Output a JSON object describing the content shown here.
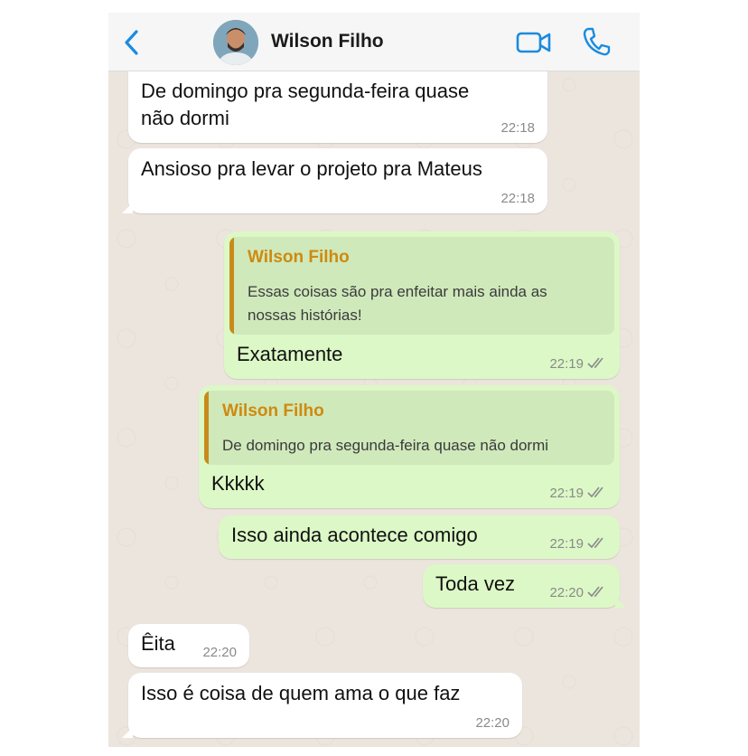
{
  "header": {
    "contact_name": "Wilson Filho",
    "icons": [
      "back-chevron-icon",
      "video-call-icon",
      "voice-call-icon"
    ],
    "accent_color": "#1a8be0"
  },
  "messages": [
    {
      "direction": "in",
      "text_lines": [
        "De domingo pra segunda-feira quase",
        "não dormi"
      ],
      "time": "22:18"
    },
    {
      "direction": "in",
      "text": "Ansioso pra levar o projeto pra Mateus",
      "time": "22:18"
    },
    {
      "direction": "out",
      "quote_author": "Wilson Filho",
      "quote_lines": [
        "Essas coisas são pra enfeitar mais ainda as",
        "nossas histórias!"
      ],
      "text": "Exatamente",
      "time": "22:19",
      "status": "read"
    },
    {
      "direction": "out",
      "quote_author": "Wilson Filho",
      "quote_lines": [
        "De domingo pra segunda-feira quase não dormi"
      ],
      "text": "Kkkkk",
      "time": "22:19",
      "status": "read"
    },
    {
      "direction": "out",
      "text": "Isso ainda acontece comigo",
      "time": "22:19",
      "status": "read"
    },
    {
      "direction": "out",
      "text": "Toda vez",
      "time": "22:20",
      "status": "read"
    },
    {
      "direction": "in",
      "text": "Êita",
      "time": "22:20"
    },
    {
      "direction": "in",
      "text": "Isso é coisa de quem ama o que faz",
      "time": "22:20"
    }
  ],
  "colors": {
    "incoming_bubble": "#ffffff",
    "outgoing_bubble": "#dcf8c6",
    "quote_author": "#cf8a0e",
    "chat_background": "#ece5dd"
  }
}
